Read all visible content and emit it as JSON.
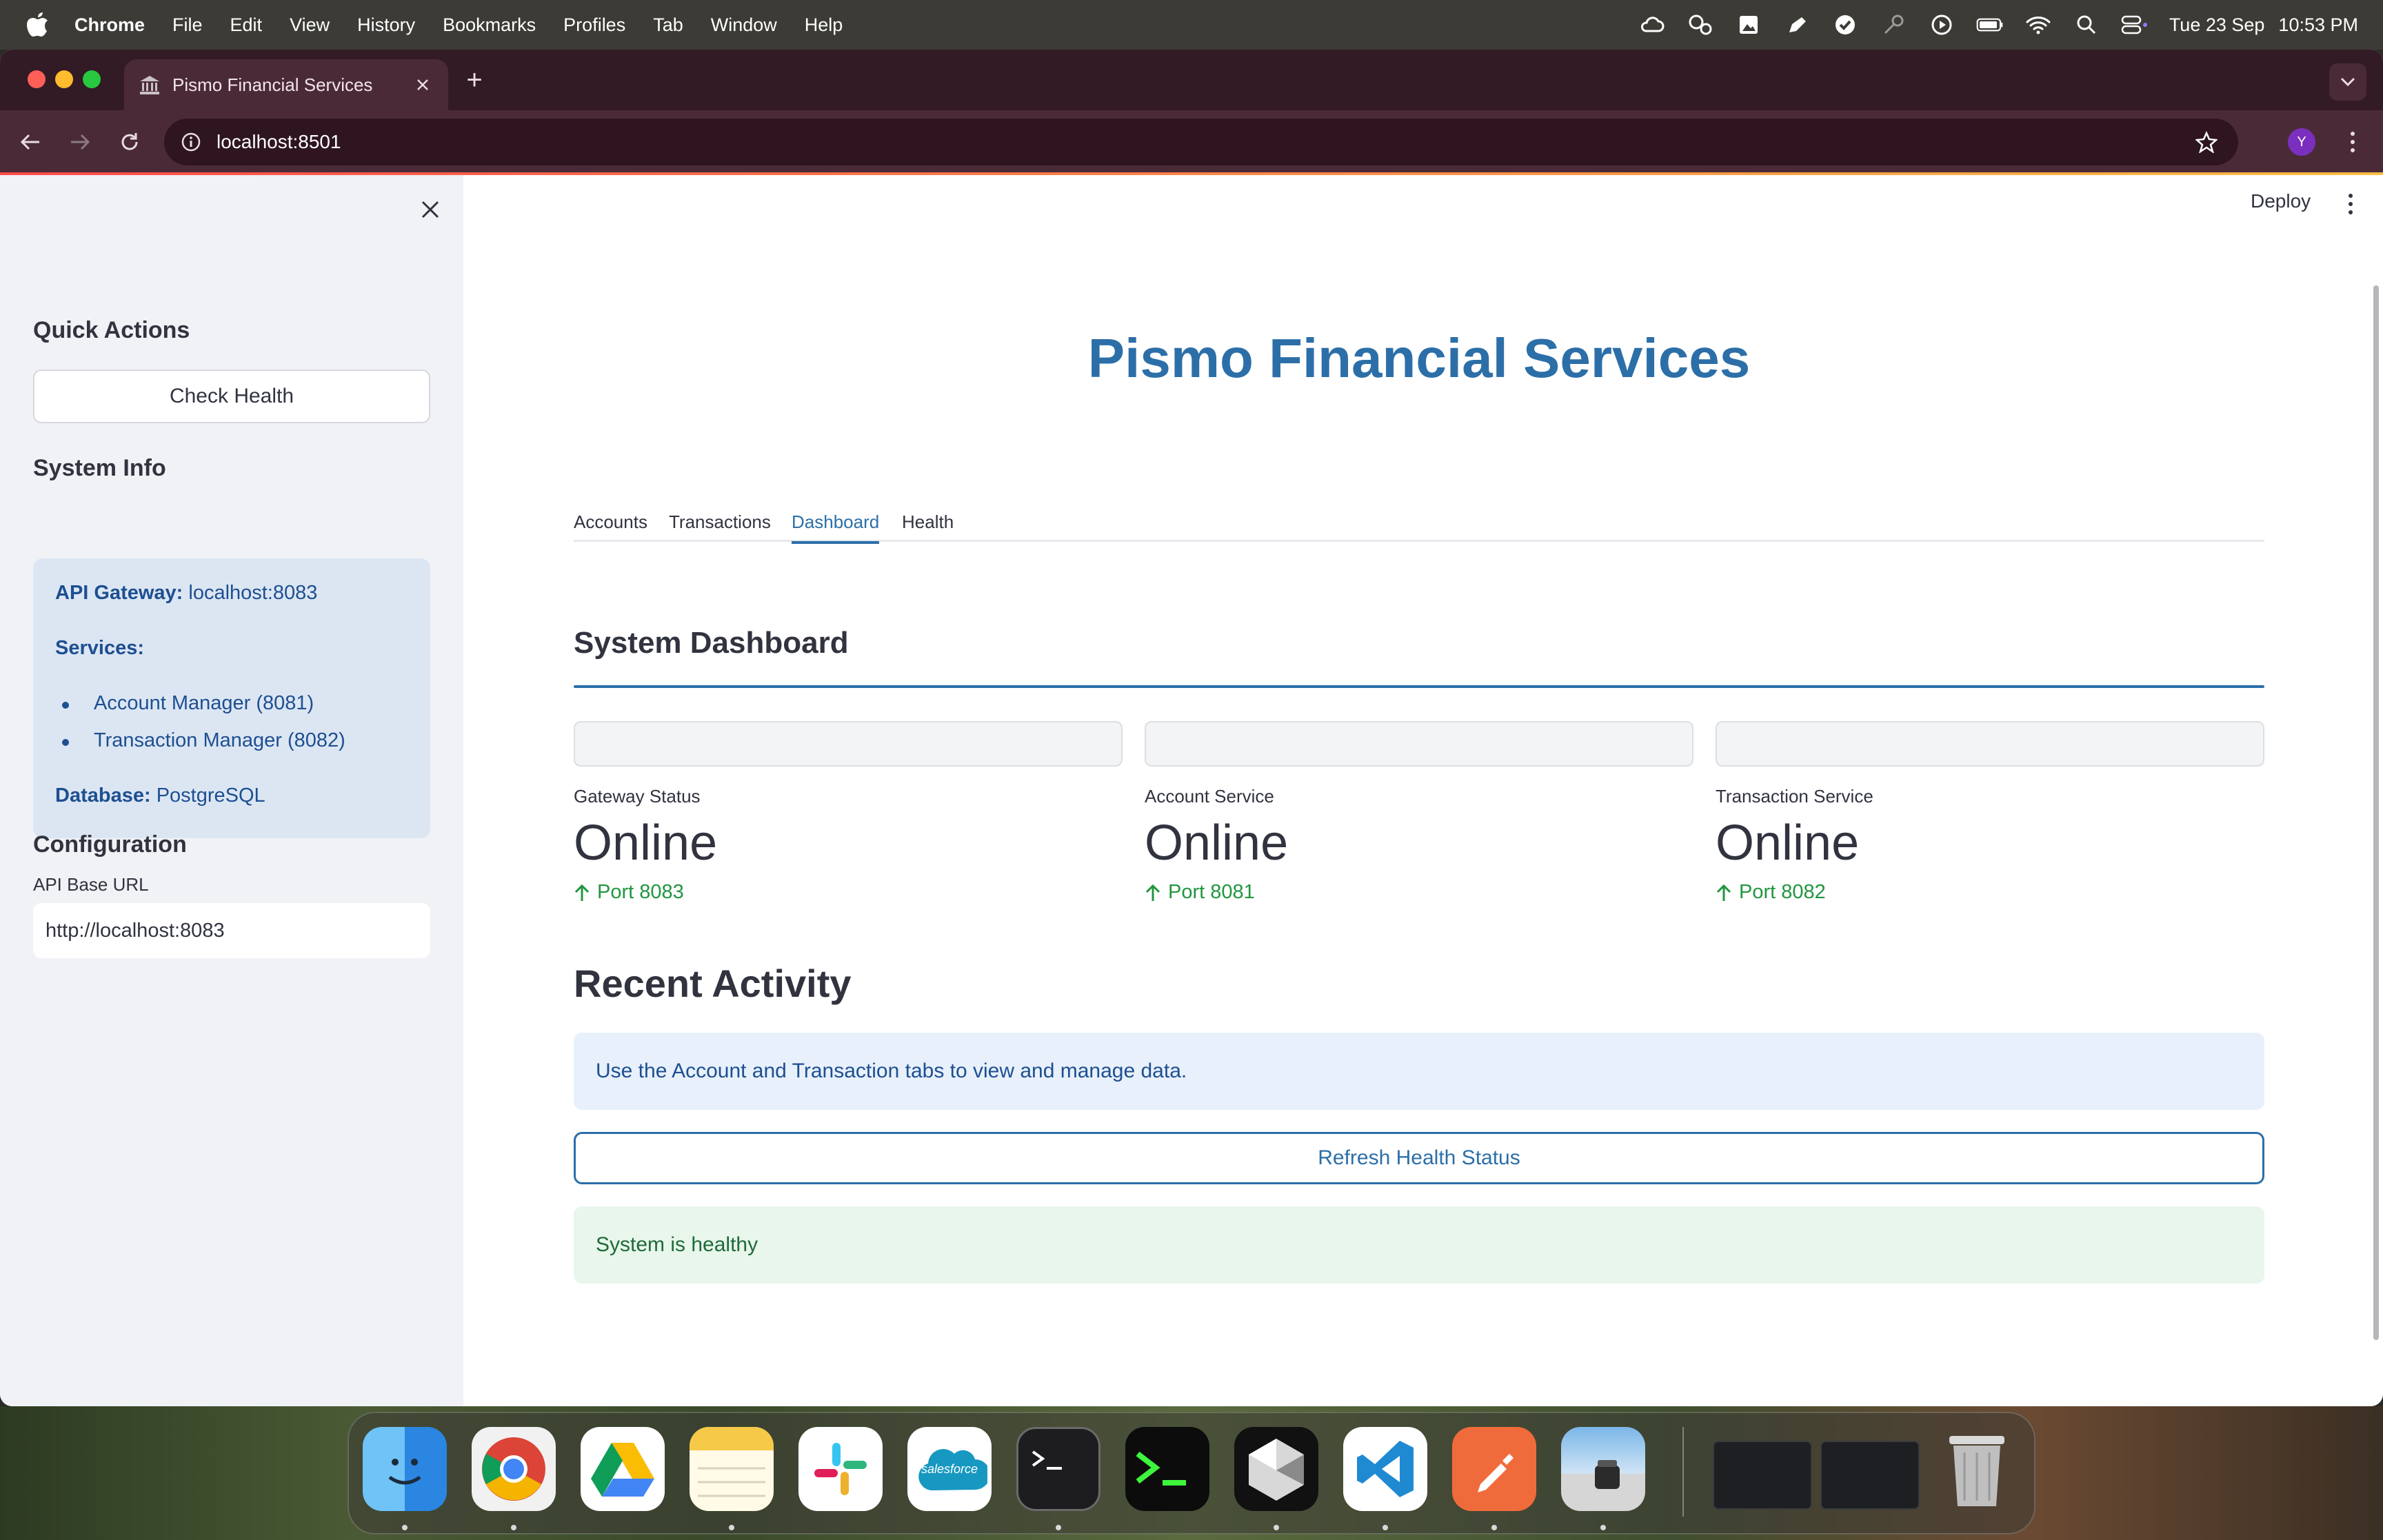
{
  "menubar": {
    "app_name": "Chrome",
    "items": [
      "File",
      "Edit",
      "View",
      "History",
      "Bookmarks",
      "Profiles",
      "Tab",
      "Window",
      "Help"
    ],
    "date": "Tue 23 Sep",
    "time": "10:53 PM"
  },
  "browser": {
    "tab_title": "Pismo Financial Services",
    "url": "localhost:8501",
    "profile_initial": "Y"
  },
  "header": {
    "deploy_label": "Deploy"
  },
  "sidebar": {
    "quick_actions_title": "Quick Actions",
    "check_health_label": "Check Health",
    "system_info_title": "System Info",
    "info": {
      "gateway_key": "API Gateway:",
      "gateway_value": "localhost:8083",
      "services_key": "Services:",
      "services": [
        "Account Manager (8081)",
        "Transaction Manager (8082)"
      ],
      "database_key": "Database:",
      "database_value": "PostgreSQL"
    },
    "configuration_title": "Configuration",
    "api_url_label": "API Base URL",
    "api_url_value": "http://localhost:8083"
  },
  "main": {
    "title": "Pismo Financial Services",
    "tabs": [
      {
        "label": "Accounts",
        "active": false
      },
      {
        "label": "Transactions",
        "active": false
      },
      {
        "label": "Dashboard",
        "active": true
      },
      {
        "label": "Health",
        "active": false
      }
    ],
    "dashboard_title": "System Dashboard",
    "metrics": [
      {
        "label": "Gateway Status",
        "value": "Online",
        "delta": "Port 8083"
      },
      {
        "label": "Account Service",
        "value": "Online",
        "delta": "Port 8081"
      },
      {
        "label": "Transaction Service",
        "value": "Online",
        "delta": "Port 8082"
      }
    ],
    "recent_title": "Recent Activity",
    "info_message": "Use the Account and Transaction tabs to view and manage data.",
    "refresh_label": "Refresh Health Status",
    "success_message": "System is healthy"
  },
  "dock": {
    "apps": [
      "finder-icon",
      "chrome-icon",
      "google-drive-icon",
      "notes-icon",
      "slack-icon",
      "salesforce-icon",
      "terminal-icon",
      "iterm-icon",
      "cursor-icon",
      "vscode-icon",
      "postman-icon",
      "preview-icon"
    ],
    "salesforce_text": "salesforce"
  },
  "colors": {
    "accent": "#2c6fa8",
    "success": "#21963f",
    "sidebar_bg": "#f0f2f6",
    "tab_strip": "#321b25"
  }
}
